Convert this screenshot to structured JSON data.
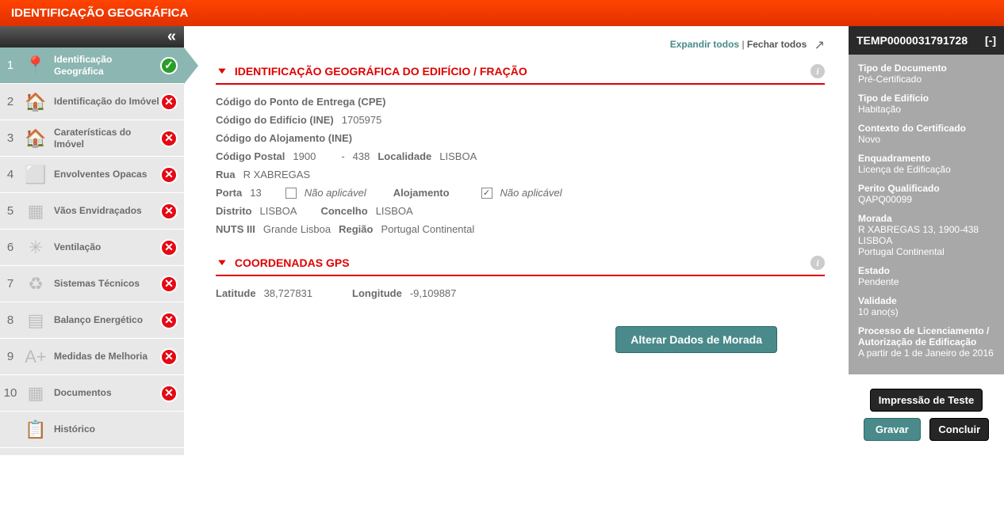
{
  "header": {
    "title": "IDENTIFICAÇÃO GEOGRÁFICA"
  },
  "sidebar": {
    "items": [
      {
        "num": "1",
        "label": "Identificação Geográfica",
        "status": "ok",
        "active": true
      },
      {
        "num": "2",
        "label": "Identificação do Imóvel",
        "status": "err"
      },
      {
        "num": "3",
        "label": "Caraterísticas do Imóvel",
        "status": "err"
      },
      {
        "num": "4",
        "label": "Envolventes Opacas",
        "status": "err"
      },
      {
        "num": "5",
        "label": "Vãos Envidraçados",
        "status": "err"
      },
      {
        "num": "6",
        "label": "Ventilação",
        "status": "err"
      },
      {
        "num": "7",
        "label": "Sistemas Técnicos",
        "status": "err"
      },
      {
        "num": "8",
        "label": "Balanço Energético",
        "status": "err"
      },
      {
        "num": "9",
        "label": "Medidas de Melhoria",
        "status": "err"
      },
      {
        "num": "10",
        "label": "Documentos",
        "status": "err"
      },
      {
        "num": "",
        "label": "Histórico",
        "status": ""
      }
    ]
  },
  "main": {
    "top": {
      "expand": "Expandir todos",
      "separator": " | ",
      "collapse": "Fechar todos"
    },
    "section1": {
      "title": "IDENTIFICAÇÃO GEOGRÁFICA DO EDIFÍCIO / FRAÇÃO",
      "cpe_label": "Código do Ponto de Entrega (CPE)",
      "cpe_value": "",
      "ine_ed_label": "Código do Edifício (INE)",
      "ine_ed_value": "1705975",
      "ine_aloj_label": "Código do Alojamento (INE)",
      "ine_aloj_value": "",
      "cp_label": "Código Postal",
      "cp_p1": "1900",
      "cp_dash": "-",
      "cp_p2": "438",
      "loc_label": "Localidade",
      "loc_value": "LISBOA",
      "rua_label": "Rua",
      "rua_value": "R XABREGAS",
      "porta_label": "Porta",
      "porta_value": "13",
      "porta_na": "Não aplicável",
      "aloj_label": "Alojamento",
      "aloj_na": "Não aplicável",
      "dist_label": "Distrito",
      "dist_value": "LISBOA",
      "conc_label": "Concelho",
      "conc_value": "LISBOA",
      "nuts_label": "NUTS III",
      "nuts_value": "Grande Lisboa",
      "reg_label": "Região",
      "reg_value": "Portugal Continental"
    },
    "section2": {
      "title": "COORDENADAS GPS",
      "lat_label": "Latitude",
      "lat_value": "38,727831",
      "lon_label": "Longitude",
      "lon_value": "-9,109887"
    },
    "button": "Alterar Dados de Morada"
  },
  "right": {
    "header_id": "TEMP0000031791728",
    "header_toggle": "[-]",
    "fields": [
      {
        "l": "Tipo de Documento",
        "v": "Pré-Certificado"
      },
      {
        "l": "Tipo de Edifício",
        "v": "Habitação"
      },
      {
        "l": "Contexto do Certificado",
        "v": "Novo"
      },
      {
        "l": "Enquadramento",
        "v": "Licença de Edificação"
      },
      {
        "l": "Perito Qualificado",
        "v": "QAPQ00099"
      },
      {
        "l": "Morada",
        "v": "R XABREGAS 13, 1900-438 LISBOA\nPortugal Continental"
      },
      {
        "l": "Estado",
        "v": "Pendente"
      },
      {
        "l": "Validade",
        "v": "10 ano(s)"
      },
      {
        "l": "Processo de Licenciamento / Autorização de Edificação",
        "v": "A partir de 1 de Janeiro de 2016"
      }
    ],
    "btn_print": "Impressão de Teste",
    "btn_save": "Gravar",
    "btn_finish": "Concluir"
  }
}
